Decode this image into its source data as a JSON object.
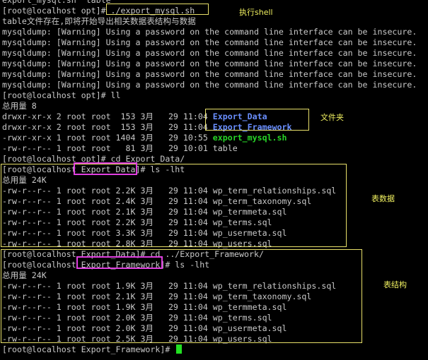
{
  "terminal": {
    "lines": [
      {
        "segments": [
          {
            "text": "export_mysql.sh  table",
            "style": "plain"
          }
        ]
      },
      {
        "segments": [
          {
            "text": "[root@localhost opt]# ./export_mysql.sh",
            "style": "plain"
          }
        ]
      },
      {
        "segments": [
          {
            "text": "table文件存在,即将开始导出相关数据表结构与数据",
            "style": "plain"
          }
        ]
      },
      {
        "segments": [
          {
            "text": "mysqldump: [Warning] Using a password on the command line interface can be insecure.",
            "style": "plain"
          }
        ]
      },
      {
        "segments": [
          {
            "text": "mysqldump: [Warning] Using a password on the command line interface can be insecure.",
            "style": "plain"
          }
        ]
      },
      {
        "segments": [
          {
            "text": "mysqldump: [Warning] Using a password on the command line interface can be insecure.",
            "style": "plain"
          }
        ]
      },
      {
        "segments": [
          {
            "text": "mysqldump: [Warning] Using a password on the command line interface can be insecure.",
            "style": "plain"
          }
        ]
      },
      {
        "segments": [
          {
            "text": "mysqldump: [Warning] Using a password on the command line interface can be insecure.",
            "style": "plain"
          }
        ]
      },
      {
        "segments": [
          {
            "text": "mysqldump: [Warning] Using a password on the command line interface can be insecure.",
            "style": "plain"
          }
        ]
      },
      {
        "segments": [
          {
            "text": "[root@localhost opt]# ll",
            "style": "plain"
          }
        ]
      },
      {
        "segments": [
          {
            "text": "总用量 8",
            "style": "plain"
          }
        ]
      },
      {
        "segments": [
          {
            "text": "drwxr-xr-x 2 root root  153 3月   29 11:04 ",
            "style": "plain"
          },
          {
            "text": "Export_Data",
            "style": "blue"
          }
        ]
      },
      {
        "segments": [
          {
            "text": "drwxr-xr-x 2 root root  153 3月   29 11:04 ",
            "style": "plain"
          },
          {
            "text": "Export_Framework",
            "style": "blue"
          }
        ]
      },
      {
        "segments": [
          {
            "text": "-rwxr-xr-x 1 root root 1404 3月   29 10:55 ",
            "style": "plain"
          },
          {
            "text": "export_mysql.sh",
            "style": "green"
          }
        ]
      },
      {
        "segments": [
          {
            "text": "-rw-r--r-- 1 root root   81 3月   29 10:01 table",
            "style": "plain"
          }
        ]
      },
      {
        "segments": [
          {
            "text": "[root@localhost opt]# cd Export_Data/",
            "style": "plain"
          }
        ]
      },
      {
        "segments": [
          {
            "text": "[root@localhost Export_Data]# ls -lht",
            "style": "plain"
          }
        ]
      },
      {
        "segments": [
          {
            "text": "总用量 24K",
            "style": "plain"
          }
        ]
      },
      {
        "segments": [
          {
            "text": "-rw-r--r-- 1 root root 2.2K 3月   29 11:04 wp_term_relationships.sql",
            "style": "plain"
          }
        ]
      },
      {
        "segments": [
          {
            "text": "-rw-r--r-- 1 root root 2.4K 3月   29 11:04 wp_term_taxonomy.sql",
            "style": "plain"
          }
        ]
      },
      {
        "segments": [
          {
            "text": "-rw-r--r-- 1 root root 2.1K 3月   29 11:04 wp_termmeta.sql",
            "style": "plain"
          }
        ]
      },
      {
        "segments": [
          {
            "text": "-rw-r--r-- 1 root root 2.2K 3月   29 11:04 wp_terms.sql",
            "style": "plain"
          }
        ]
      },
      {
        "segments": [
          {
            "text": "-rw-r--r-- 1 root root 3.3K 3月   29 11:04 wp_usermeta.sql",
            "style": "plain"
          }
        ]
      },
      {
        "segments": [
          {
            "text": "-rw-r--r-- 1 root root 2.8K 3月   29 11:04 wp_users.sql",
            "style": "plain"
          }
        ]
      },
      {
        "segments": [
          {
            "text": "[root@localhost Export_Data]# cd ../Export_Framework/",
            "style": "plain"
          }
        ]
      },
      {
        "segments": [
          {
            "text": "[root@localhost Export_Framework]# ls -lht",
            "style": "plain"
          }
        ]
      },
      {
        "segments": [
          {
            "text": "总用量 24K",
            "style": "plain"
          }
        ]
      },
      {
        "segments": [
          {
            "text": "-rw-r--r-- 1 root root 1.9K 3月   29 11:04 wp_term_relationships.sql",
            "style": "plain"
          }
        ]
      },
      {
        "segments": [
          {
            "text": "-rw-r--r-- 1 root root 2.1K 3月   29 11:04 wp_term_taxonomy.sql",
            "style": "plain"
          }
        ]
      },
      {
        "segments": [
          {
            "text": "-rw-r--r-- 1 root root 1.9K 3月   29 11:04 wp_termmeta.sql",
            "style": "plain"
          }
        ]
      },
      {
        "segments": [
          {
            "text": "-rw-r--r-- 1 root root 2.0K 3月   29 11:04 wp_terms.sql",
            "style": "plain"
          }
        ]
      },
      {
        "segments": [
          {
            "text": "-rw-r--r-- 1 root root 2.0K 3月   29 11:04 wp_usermeta.sql",
            "style": "plain"
          }
        ]
      },
      {
        "segments": [
          {
            "text": "-rw-r--r-- 1 root root 2.5K 3月   29 11:04 wp_users.sql",
            "style": "plain"
          }
        ]
      },
      {
        "segments": [
          {
            "text": "[root@localhost Export_Framework]# ",
            "style": "plain"
          }
        ],
        "cursor": true
      }
    ]
  },
  "annotations": {
    "run_shell": "执行shell",
    "folders": "文件夹",
    "table_data": "表数据",
    "table_structure": "表结构"
  },
  "colors": {
    "background": "#000000",
    "text": "#c8c8c8",
    "directory": "#6a8fff",
    "executable": "#27d527",
    "annotation": "#f0f060",
    "box_yellow": "#e8e06a",
    "box_magenta": "#e040e0",
    "cursor": "#22e022"
  }
}
